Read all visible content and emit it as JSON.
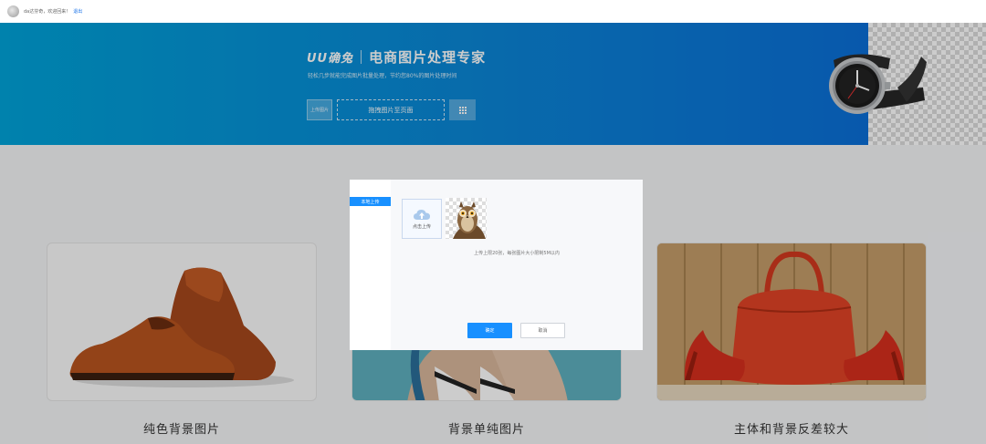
{
  "topbar": {
    "welcome": "da达芬奇，欢迎回来！",
    "logout": "退出"
  },
  "banner": {
    "logo": "UU确兔",
    "title": "电商图片处理专家",
    "slogan": "轻松几步就能完成图片批量处理，节约您80%的图片处理时间",
    "upload_label": "上传图片",
    "drag_label": "拖拽图片至页面",
    "grid_icon": "grid-icon"
  },
  "cards": [
    {
      "title": "纯色背景图片"
    },
    {
      "title": "背景单纯图片"
    },
    {
      "title": "主体和背景反差较大"
    }
  ],
  "dialog": {
    "tab_local": "本地上传",
    "upload_tile_label": "点击上传",
    "hint": "上传上限20张，每张图片大小限制5M以内",
    "ok_label": "确定",
    "cancel_label": "取消"
  },
  "colors": {
    "accent": "#1890ff",
    "banner_start": "#00a3d9",
    "banner_end": "#0a6fd8"
  }
}
